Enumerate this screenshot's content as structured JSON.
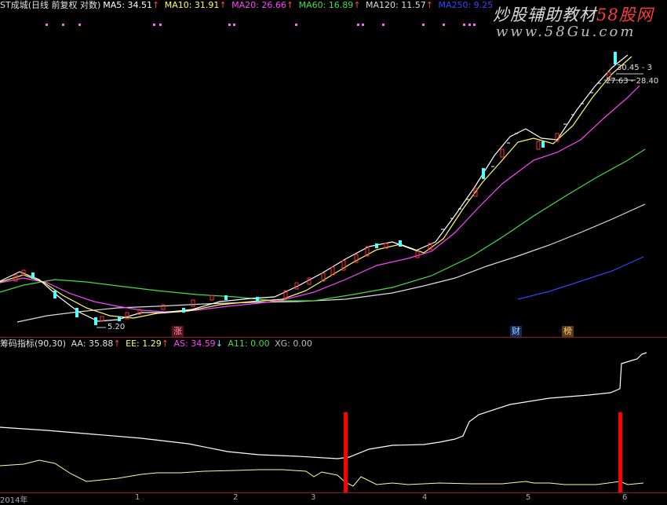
{
  "header": {
    "title": "ST成城(日线 前复权 对数)",
    "ma5": "MA5: 34.51",
    "ma10": "MA10: 31.91",
    "ma20": "MA20: 26.66",
    "ma60": "MA60: 16.89",
    "ma120": "MA120: 11.57",
    "ma250": "MA250: 9.25",
    "arrow": "↑"
  },
  "watermark": {
    "brand_cn": "炒股辅助教材",
    "brand_num": "58股网",
    "url": "www.58Gu.com"
  },
  "main_chart": {
    "low_label": "5.20",
    "high_label": "30.45 - 3",
    "range_label": "27.63 - 28.40",
    "tags": [
      "涨",
      "财",
      "榜"
    ]
  },
  "indicator": {
    "name": "筹码指标(90,30)",
    "aa": "AA: 35.88",
    "ee": "EE: 1.29",
    "as": "AS: 34.59",
    "a11": "A11: 0.00",
    "xg": "XG: 0.00",
    "up": "↑",
    "down": "↓"
  },
  "x_axis": [
    "2014年",
    "1",
    "2",
    "3",
    "4",
    "5",
    "6"
  ],
  "colors": {
    "ma5": "#ffffff",
    "ma10": "#ffff66",
    "ma20": "#ff44ff",
    "ma60": "#44dd44",
    "ma120": "#dddddd",
    "ma250": "#3344ff",
    "up_candle": "#ff3333",
    "down_candle": "#54ffff",
    "signal_bar": "#ff0000"
  }
}
